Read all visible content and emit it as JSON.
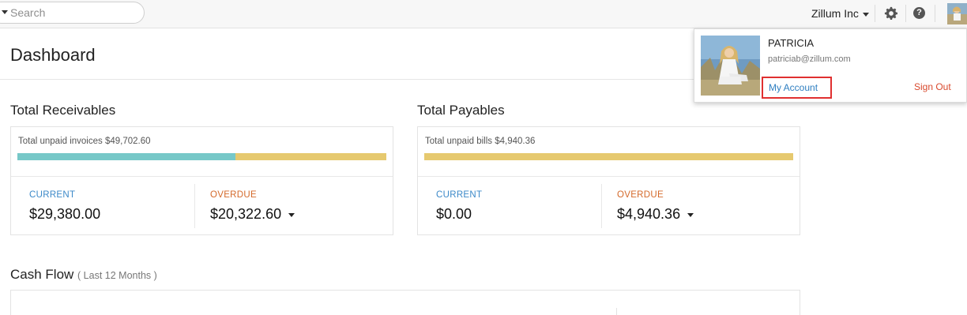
{
  "topbar": {
    "search_placeholder": "Search",
    "org_name": "Zillum Inc",
    "icons": [
      "search-caret-icon",
      "gear-icon",
      "help-icon",
      "avatar"
    ]
  },
  "page": {
    "title": "Dashboard"
  },
  "receivables": {
    "title": "Total Receivables",
    "unpaid_label": "Total unpaid invoices $49,702.60",
    "current_label": "CURRENT",
    "current_value": "$29,380.00",
    "overdue_label": "OVERDUE",
    "overdue_value": "$20,322.60",
    "current_fraction": 0.591
  },
  "payables": {
    "title": "Total Payables",
    "unpaid_label": "Total unpaid bills $4,940.36",
    "current_label": "CURRENT",
    "current_value": "$0.00",
    "overdue_label": "OVERDUE",
    "overdue_value": "$4,940.36",
    "current_fraction": 0.0
  },
  "cashflow": {
    "title": "Cash Flow",
    "subtitle": "( Last 12 Months )"
  },
  "account_popover": {
    "name": "PATRICIA",
    "email": "patriciab@zillum.com",
    "my_account_label": "My Account",
    "sign_out_label": "Sign Out"
  },
  "colors": {
    "current_bar": "#77c8c8",
    "overdue_bar": "#e6c96f",
    "current_label": "#3c89c8",
    "overdue_label": "#d4692a",
    "link": "#2f7fc1",
    "sign_out": "#d94a2e",
    "highlight_box": "#e03030"
  }
}
